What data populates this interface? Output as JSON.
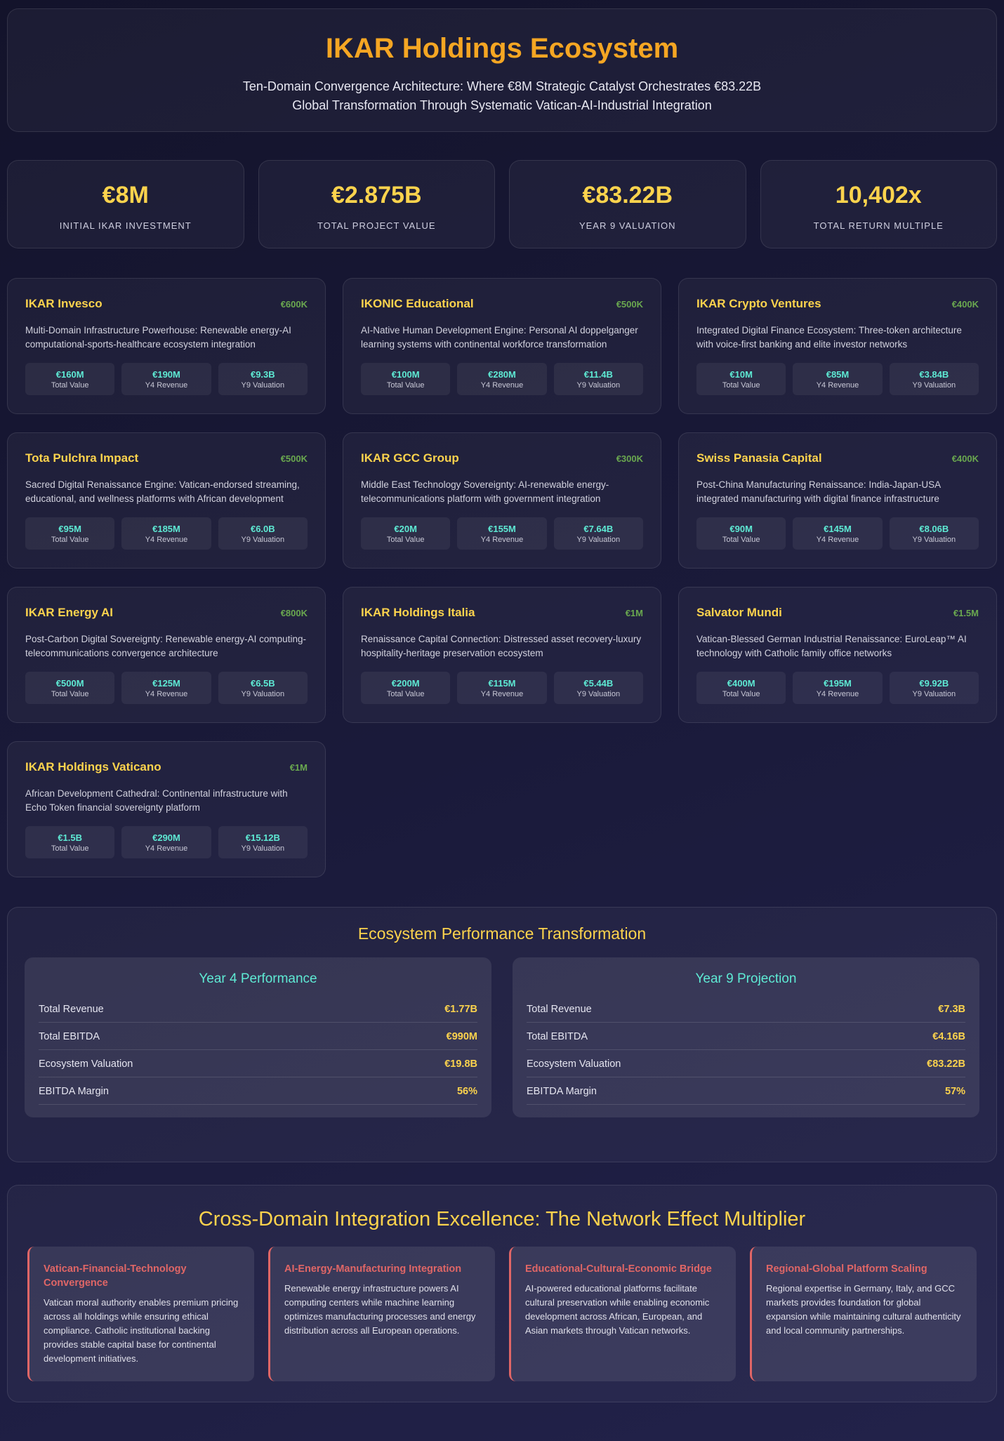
{
  "header": {
    "title": "IKAR Holdings Ecosystem",
    "subtitle_line1": "Ten-Domain Convergence Architecture: Where €8M Strategic Catalyst Orchestrates €83.22B",
    "subtitle_line2": "Global Transformation Through Systematic Vatican-AI-Industrial Integration"
  },
  "stats": [
    {
      "value": "€8M",
      "label": "Initial IKAR Investment"
    },
    {
      "value": "€2.875B",
      "label": "Total Project Value"
    },
    {
      "value": "€83.22B",
      "label": "Year 9 Valuation"
    },
    {
      "value": "10,402x",
      "label": "Total Return Multiple"
    }
  ],
  "metric_labels": {
    "total": "Total Value",
    "y4": "Y4 Revenue",
    "y9": "Y9 Valuation"
  },
  "companies": [
    {
      "name": "IKAR Invesco",
      "investment": "€600K",
      "description": "Multi-Domain Infrastructure Powerhouse: Renewable energy-AI computational-sports-healthcare ecosystem integration",
      "total": "€160M",
      "y4": "€190M",
      "y9": "€9.3B"
    },
    {
      "name": "IKONIC Educational",
      "investment": "€500K",
      "description": "AI-Native Human Development Engine: Personal AI doppelganger learning systems with continental workforce transformation",
      "total": "€100M",
      "y4": "€280M",
      "y9": "€11.4B"
    },
    {
      "name": "IKAR Crypto Ventures",
      "investment": "€400K",
      "description": "Integrated Digital Finance Ecosystem: Three-token architecture with voice-first banking and elite investor networks",
      "total": "€10M",
      "y4": "€85M",
      "y9": "€3.84B"
    },
    {
      "name": "Tota Pulchra Impact",
      "investment": "€500K",
      "description": "Sacred Digital Renaissance Engine: Vatican-endorsed streaming, educational, and wellness platforms with African development",
      "total": "€95M",
      "y4": "€185M",
      "y9": "€6.0B"
    },
    {
      "name": "IKAR GCC Group",
      "investment": "€300K",
      "description": "Middle East Technology Sovereignty: AI-renewable energy-telecommunications platform with government integration",
      "total": "€20M",
      "y4": "€155M",
      "y9": "€7.64B"
    },
    {
      "name": "Swiss Panasia Capital",
      "investment": "€400K",
      "description": "Post-China Manufacturing Renaissance: India-Japan-USA integrated manufacturing with digital finance infrastructure",
      "total": "€90M",
      "y4": "€145M",
      "y9": "€8.06B"
    },
    {
      "name": "IKAR Energy AI",
      "investment": "€800K",
      "description": "Post-Carbon Digital Sovereignty: Renewable energy-AI computing-telecommunications convergence architecture",
      "total": "€500M",
      "y4": "€125M",
      "y9": "€6.5B"
    },
    {
      "name": "IKAR Holdings Italia",
      "investment": "€1M",
      "description": "Renaissance Capital Connection: Distressed asset recovery-luxury hospitality-heritage preservation ecosystem",
      "total": "€200M",
      "y4": "€115M",
      "y9": "€5.44B"
    },
    {
      "name": "Salvator Mundi",
      "investment": "€1.5M",
      "description": "Vatican-Blessed German Industrial Renaissance: EuroLeap™ AI technology with Catholic family office networks",
      "total": "€400M",
      "y4": "€195M",
      "y9": "€9.92B"
    },
    {
      "name": "IKAR Holdings Vaticano",
      "investment": "€1M",
      "description": "African Development Cathedral: Continental infrastructure with Echo Token financial sovereignty platform",
      "total": "€1.5B",
      "y4": "€290M",
      "y9": "€15.12B"
    }
  ],
  "performance": {
    "title": "Ecosystem Performance Transformation",
    "boxes": [
      {
        "title": "Year 4 Performance",
        "rows": [
          {
            "label": "Total Revenue",
            "value": "€1.77B"
          },
          {
            "label": "Total EBITDA",
            "value": "€990M"
          },
          {
            "label": "Ecosystem Valuation",
            "value": "€19.8B"
          },
          {
            "label": "EBITDA Margin",
            "value": "56%"
          }
        ]
      },
      {
        "title": "Year 9 Projection",
        "rows": [
          {
            "label": "Total Revenue",
            "value": "€7.3B"
          },
          {
            "label": "Total EBITDA",
            "value": "€4.16B"
          },
          {
            "label": "Ecosystem Valuation",
            "value": "€83.22B"
          },
          {
            "label": "EBITDA Margin",
            "value": "57%"
          }
        ]
      }
    ]
  },
  "cross": {
    "title": "Cross-Domain Integration Excellence: The Network Effect Multiplier",
    "items": [
      {
        "title": "Vatican-Financial-Technology Convergence",
        "text": "Vatican moral authority enables premium pricing across all holdings while ensuring ethical compliance. Catholic institutional backing provides stable capital base for continental development initiatives."
      },
      {
        "title": "AI-Energy-Manufacturing Integration",
        "text": "Renewable energy infrastructure powers AI computing centers while machine learning optimizes manufacturing processes and energy distribution across all European operations."
      },
      {
        "title": "Educational-Cultural-Economic Bridge",
        "text": "AI-powered educational platforms facilitate cultural preservation while enabling economic development across African, European, and Asian markets through Vatican networks."
      },
      {
        "title": "Regional-Global Platform Scaling",
        "text": "Regional expertise in Germany, Italy, and GCC markets provides foundation for global expansion while maintaining cultural authenticity and local community partnerships."
      }
    ]
  },
  "colors": {
    "title": "#f5a623",
    "value": "#fcd34d",
    "investment": "#6aa84f",
    "metric": "#5eead4",
    "accent": "#e06666"
  }
}
